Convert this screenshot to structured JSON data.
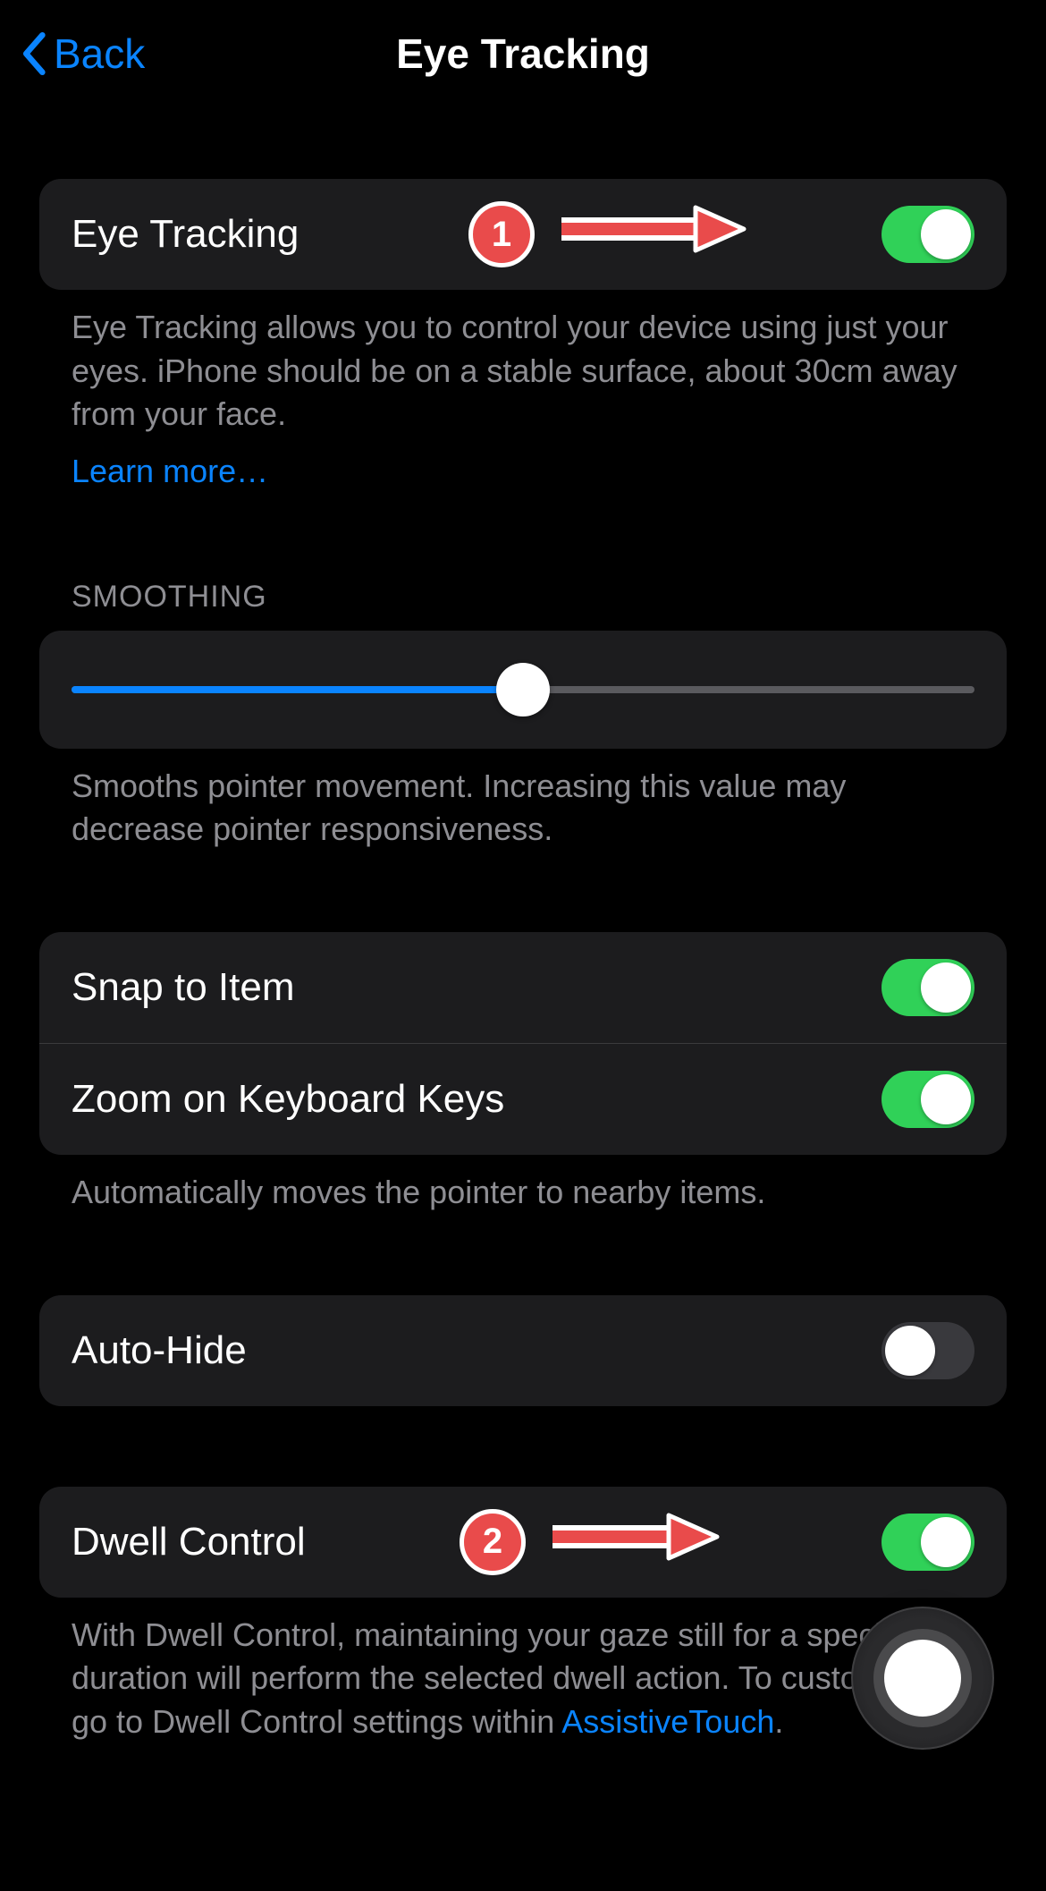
{
  "nav": {
    "back_label": "Back",
    "title": "Eye Tracking"
  },
  "section_eye_tracking": {
    "label": "Eye Tracking",
    "toggle_on": true,
    "footer": "Eye Tracking allows you to control your device using just your eyes. iPhone should be on a stable surface, about 30cm away from your face.",
    "learn_more": "Learn more…"
  },
  "section_smoothing": {
    "header": "SMOOTHING",
    "value_percent": 50,
    "footer": "Smooths pointer movement. Increasing this value may decrease pointer responsiveness."
  },
  "section_snap": {
    "items": [
      {
        "label": "Snap to Item",
        "toggle_on": true
      },
      {
        "label": "Zoom on Keyboard Keys",
        "toggle_on": true
      }
    ],
    "footer": "Automatically moves the pointer to nearby items."
  },
  "section_autohide": {
    "label": "Auto-Hide",
    "toggle_on": false
  },
  "section_dwell": {
    "label": "Dwell Control",
    "toggle_on": true,
    "footer_prefix": "With Dwell Control, maintaining your gaze still for a specified duration will perform the selected dwell action. To customize, go to Dwell Control settings within ",
    "footer_link": "AssistiveTouch",
    "footer_suffix": "."
  },
  "annotations": {
    "badge1": "1",
    "badge2": "2"
  }
}
